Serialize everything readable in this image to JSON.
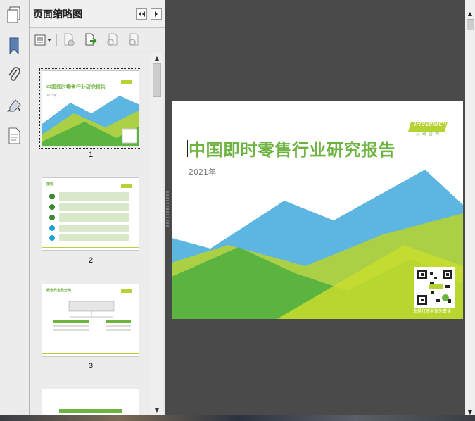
{
  "panel": {
    "title": "页面缩略图",
    "buttons": {
      "options_icon": "thumbnail-options-icon",
      "collapse_icon": "double-left-arrow-icon",
      "expand_icon": "right-arrow-icon"
    }
  },
  "rail": {
    "icons": [
      "pages-icon",
      "bookmark-icon",
      "attachment-icon",
      "signature-icon",
      "document-icon"
    ]
  },
  "toolbar": {
    "icons": [
      "options-menu-icon",
      "delete-page-icon",
      "insert-page-icon",
      "extract-page-icon",
      "replace-page-icon"
    ]
  },
  "thumbnails": [
    {
      "number": "1",
      "title": "中国即时零售行业研究报告",
      "subtitle": "2021年"
    },
    {
      "number": "2",
      "title": "摘要"
    },
    {
      "number": "3",
      "title": "概念界定及分类"
    },
    {
      "number": ""
    }
  ],
  "document": {
    "title": "中国即时零售行业研究报告",
    "year": "2021年",
    "brand": "iResearch",
    "brand_sub": "艾瑞咨询",
    "qr_caption": "海量行研报告免费读"
  },
  "colors": {
    "accent_green": "#6db33f",
    "mountain_blue": "#3fa9dc",
    "lime": "#b5d334"
  }
}
